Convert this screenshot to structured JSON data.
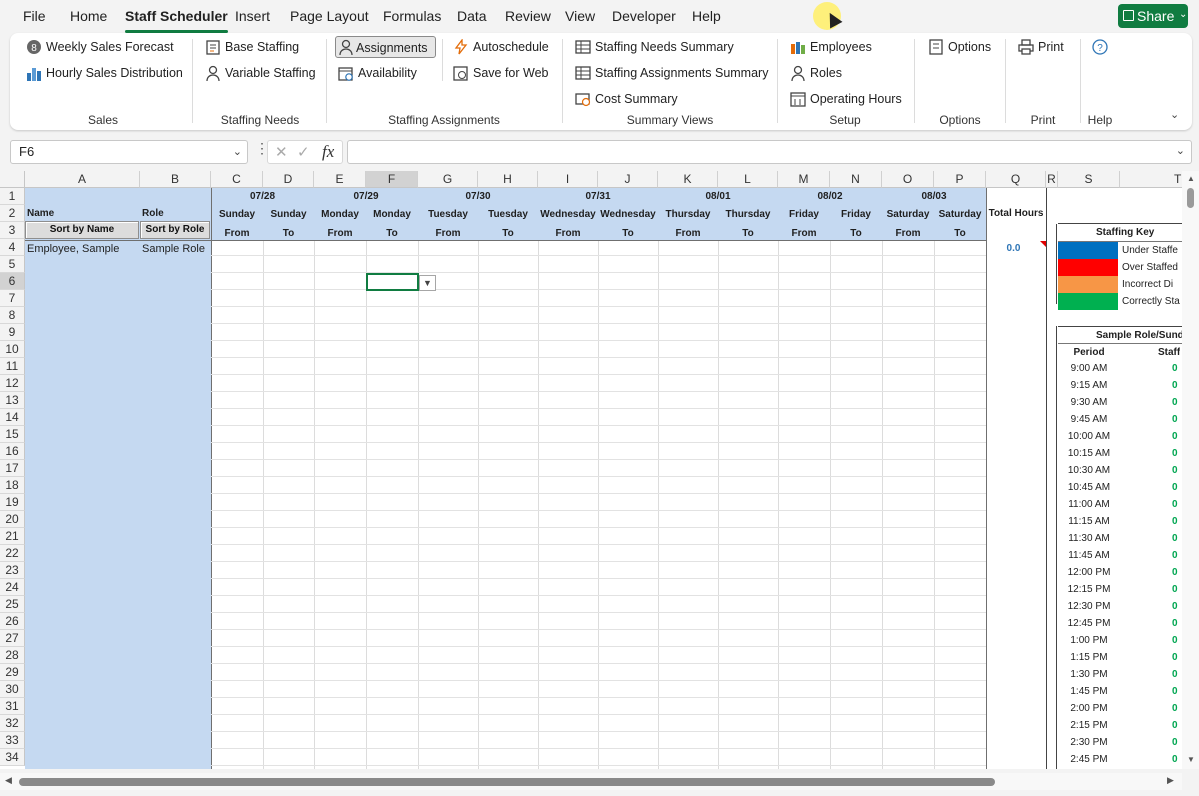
{
  "menu": {
    "tabs": [
      "File",
      "Home",
      "Staff Scheduler",
      "Insert",
      "Page Layout",
      "Formulas",
      "Data",
      "Review",
      "View",
      "Developer",
      "Help"
    ],
    "active": "Staff Scheduler",
    "share_label": "Share"
  },
  "ribbon": {
    "groups": {
      "sales": "Sales",
      "staffing_needs": "Staffing Needs",
      "staffing_assignments": "Staffing Assignments",
      "summary_views": "Summary Views",
      "setup": "Setup",
      "options": "Options",
      "print": "Print",
      "help": "Help"
    },
    "buttons": {
      "weekly_sales_forecast": "Weekly Sales Forecast",
      "hourly_sales_distribution": "Hourly Sales Distribution",
      "base_staffing": "Base Staffing",
      "variable_staffing": "Variable Staffing",
      "assignments": "Assignments",
      "availability": "Availability",
      "autoschedule": "Autoschedule",
      "save_for_web": "Save for Web",
      "staffing_needs_summary": "Staffing Needs Summary",
      "staffing_assignments_summary": "Staffing Assignments Summary",
      "cost_summary": "Cost Summary",
      "employees": "Employees",
      "roles": "Roles",
      "operating_hours": "Operating Hours",
      "options": "Options",
      "print": "Print"
    }
  },
  "formula_bar": {
    "name_box": "F6",
    "formula": ""
  },
  "columns": [
    "A",
    "B",
    "C",
    "D",
    "E",
    "F",
    "G",
    "H",
    "I",
    "J",
    "K",
    "L",
    "M",
    "N",
    "O",
    "P",
    "Q",
    "R",
    "S",
    "T"
  ],
  "rows": [
    "1",
    "2",
    "3",
    "4",
    "5",
    "6",
    "7",
    "8",
    "9",
    "10",
    "11",
    "12",
    "13",
    "14",
    "15",
    "16",
    "17",
    "18",
    "19",
    "20",
    "21",
    "22",
    "23",
    "24",
    "25",
    "26",
    "27",
    "28",
    "29",
    "30",
    "31",
    "32",
    "33",
    "34"
  ],
  "sheet": {
    "name_header": "Name",
    "role_header": "Role",
    "sort_by_name": "Sort by Name",
    "sort_by_role": "Sort by Role",
    "total_hours_header": "Total Hours",
    "dates": [
      "07/28",
      "07/29",
      "07/30",
      "07/31",
      "08/01",
      "08/02",
      "08/03"
    ],
    "days": [
      "Sunday",
      "Sunday",
      "Monday",
      "Monday",
      "Tuesday",
      "Tuesday",
      "Wednesday",
      "Wednesday",
      "Thursday",
      "Thursday",
      "Friday",
      "Friday",
      "Saturday",
      "Saturday"
    ],
    "from_to": [
      "From",
      "To",
      "From",
      "To",
      "From",
      "To",
      "From",
      "To",
      "From",
      "To",
      "From",
      "To",
      "From",
      "To"
    ],
    "employee_name": "Employee, Sample",
    "employee_role": "Sample Role",
    "total_hours_value": "0.0"
  },
  "staffing_key": {
    "title": "Staffing Key",
    "items": [
      {
        "label": "Under Staffe",
        "color": "#0070c0"
      },
      {
        "label": "Over Staffed",
        "color": "#ff0000"
      },
      {
        "label": "Incorrect Di",
        "color": "#f79646"
      },
      {
        "label": "Correctly Sta",
        "color": "#00b050"
      }
    ]
  },
  "sample_table": {
    "title": "Sample Role/Sund",
    "period_header": "Period",
    "staff_header": "Staff",
    "periods": [
      "9:00 AM",
      "9:15 AM",
      "9:30 AM",
      "9:45 AM",
      "10:00 AM",
      "10:15 AM",
      "10:30 AM",
      "10:45 AM",
      "11:00 AM",
      "11:15 AM",
      "11:30 AM",
      "11:45 AM",
      "12:00 PM",
      "12:15 PM",
      "12:30 PM",
      "12:45 PM",
      "1:00 PM",
      "1:15 PM",
      "1:30 PM",
      "1:45 PM",
      "2:00 PM",
      "2:15 PM",
      "2:30 PM",
      "2:45 PM"
    ],
    "staff_values": [
      "0",
      "0",
      "0",
      "0",
      "0",
      "0",
      "0",
      "0",
      "0",
      "0",
      "0",
      "0",
      "0",
      "0",
      "0",
      "0",
      "0",
      "0",
      "0",
      "0",
      "0",
      "0",
      "0",
      "0"
    ]
  },
  "colors": {
    "accent": "#107c41",
    "header_band": "#c5d9f1",
    "total_value": "#2e75b6"
  }
}
